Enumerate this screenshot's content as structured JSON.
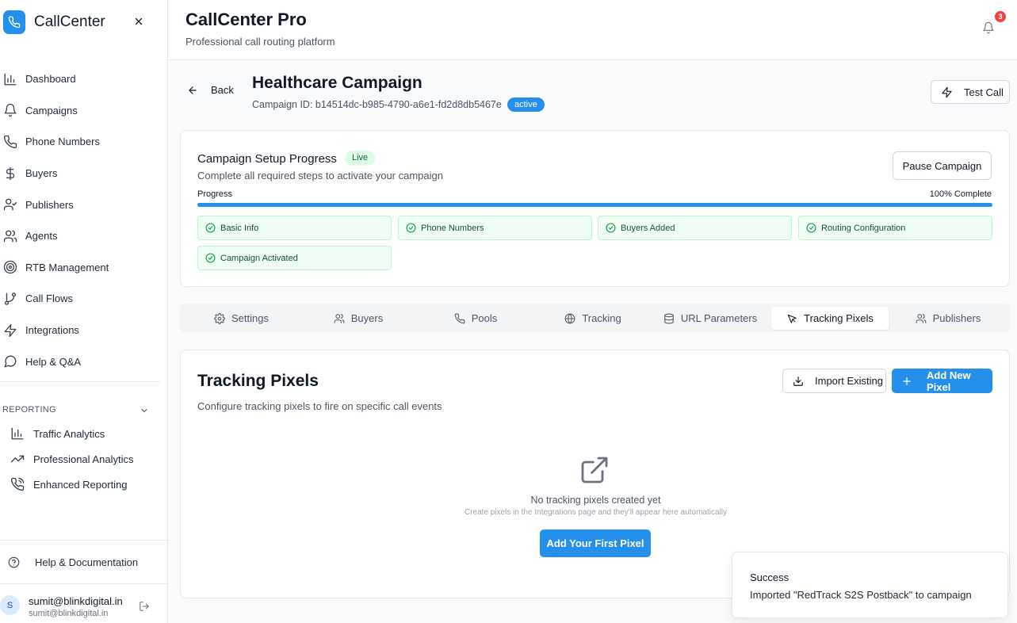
{
  "brand": {
    "name": "CallCenter"
  },
  "sidebar": {
    "items": [
      {
        "label": "Dashboard",
        "icon": "bar-chart-icon"
      },
      {
        "label": "Campaigns",
        "icon": "bell-icon"
      },
      {
        "label": "Phone Numbers",
        "icon": "phone-icon"
      },
      {
        "label": "Buyers",
        "icon": "dollar-icon"
      },
      {
        "label": "Publishers",
        "icon": "user-check-icon"
      },
      {
        "label": "Agents",
        "icon": "users-icon"
      },
      {
        "label": "RTB Management",
        "icon": "target-icon"
      },
      {
        "label": "Call Flows",
        "icon": "git-branch-icon"
      },
      {
        "label": "Integrations",
        "icon": "zap-icon"
      },
      {
        "label": "Help & Q&A",
        "icon": "message-circle-icon"
      }
    ],
    "reporting_label": "REPORTING",
    "reporting_items": [
      {
        "label": "Traffic Analytics",
        "icon": "bar-chart-icon"
      },
      {
        "label": "Professional Analytics",
        "icon": "trending-up-icon"
      },
      {
        "label": "Enhanced Reporting",
        "icon": "phone-call-icon"
      }
    ],
    "help_docs": "Help & Documentation",
    "user": {
      "initial": "S",
      "name": "sumit@blinkdigital.in",
      "email": "sumit@blinkdigital.in"
    }
  },
  "header": {
    "title": "CallCenter Pro",
    "subtitle": "Professional call routing platform",
    "notification_count": "3"
  },
  "campaign": {
    "back_label": "Back",
    "title": "Healthcare Campaign",
    "id_text": "Campaign ID: b14514dc-b985-4790-a6e1-fd2d8db5467e",
    "status": "active",
    "test_call_label": "Test Call"
  },
  "setup": {
    "title": "Campaign Setup Progress",
    "live_badge": "Live",
    "subtitle": "Complete all required steps to activate your campaign",
    "pause_label": "Pause Campaign",
    "progress_label": "Progress",
    "progress_text": "100% Complete",
    "progress_percent": 100,
    "steps": [
      {
        "label": "Basic Info"
      },
      {
        "label": "Phone Numbers"
      },
      {
        "label": "Buyers Added"
      },
      {
        "label": "Routing Configuration"
      },
      {
        "label": "Campaign Activated"
      }
    ]
  },
  "tabs": [
    {
      "label": "Settings",
      "icon": "gear-icon"
    },
    {
      "label": "Buyers",
      "icon": "users-icon"
    },
    {
      "label": "Pools",
      "icon": "phone-icon"
    },
    {
      "label": "Tracking",
      "icon": "globe-icon"
    },
    {
      "label": "URL Parameters",
      "icon": "database-icon"
    },
    {
      "label": "Tracking Pixels",
      "icon": "cursor-icon",
      "active": true
    },
    {
      "label": "Publishers",
      "icon": "users-icon"
    }
  ],
  "pixels": {
    "title": "Tracking Pixels",
    "subtitle": "Configure tracking pixels to fire on specific call events",
    "import_label": "Import Existing",
    "add_label": "Add New Pixel",
    "empty_title": "No tracking pixels created yet",
    "empty_sub": "Create pixels in the Integrations page and they'll appear here automatically",
    "first_pixel_label": "Add Your First Pixel"
  },
  "toast": {
    "title": "Success",
    "message": "Imported \"RedTrack S2S Postback\" to campaign"
  },
  "colors": {
    "accent": "#2590eb",
    "success_bg": "#f0fdf4",
    "success_border": "#bbf7d0",
    "badge_red": "#ef4444"
  }
}
